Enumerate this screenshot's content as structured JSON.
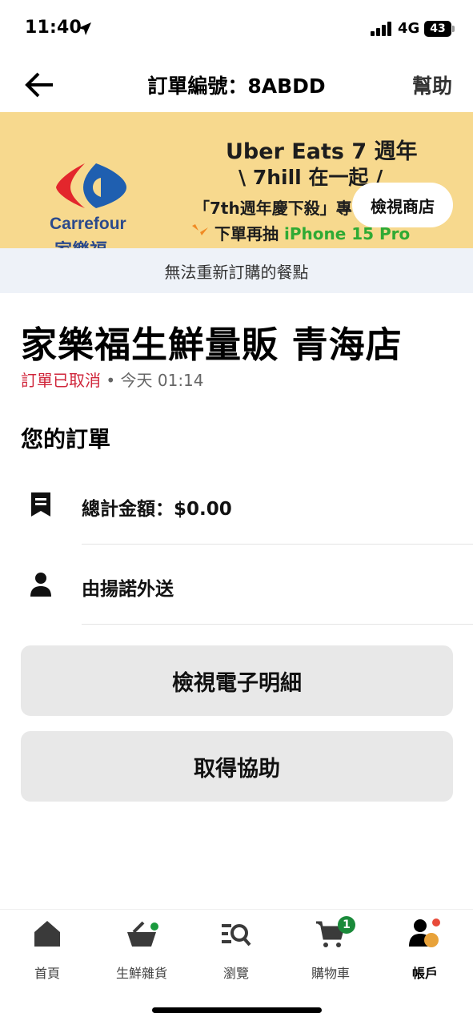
{
  "status_bar": {
    "time": "11:40",
    "network": "4G",
    "battery": "43"
  },
  "header": {
    "title": "訂單編號：8ABDD",
    "help": "幫助"
  },
  "banner": {
    "brand_name": "Carrefour",
    "brand_cn": "家樂福",
    "line1": "Uber Eats 7 週年",
    "line2": "\\ 7hill 在一起 /",
    "line3": "「7th週年慶下殺」專",
    "line4_prefix": "下單再抽 ",
    "line4_highlight": "iPhone 15 Pro",
    "view_store_button": "檢視商店"
  },
  "notice": "無法重新訂購的餐點",
  "store": {
    "name": "家樂福生鮮量販 青海店",
    "status": "訂單已取消",
    "separator": " • ",
    "time": "今天 01:14"
  },
  "order": {
    "section_title": "您的訂單",
    "total": "總計金額：$0.00",
    "courier": "由揚諾外送"
  },
  "buttons": {
    "receipt": "檢視電子明細",
    "help": "取得協助"
  },
  "bottom_nav": {
    "items": [
      {
        "label": "首頁",
        "icon": "home-icon"
      },
      {
        "label": "生鮮雜貨",
        "icon": "grocery-basket-icon"
      },
      {
        "label": "瀏覽",
        "icon": "browse-icon"
      },
      {
        "label": "購物車",
        "icon": "cart-icon",
        "badge": "1"
      },
      {
        "label": "帳戶",
        "icon": "account-icon",
        "active": true
      }
    ]
  },
  "colors": {
    "banner_bg": "#f7d98e",
    "cancel_red": "#d0263b",
    "brand_blue": "#2b4a8c",
    "brand_red": "#e3262c",
    "accent_green": "#1a8a3a"
  }
}
